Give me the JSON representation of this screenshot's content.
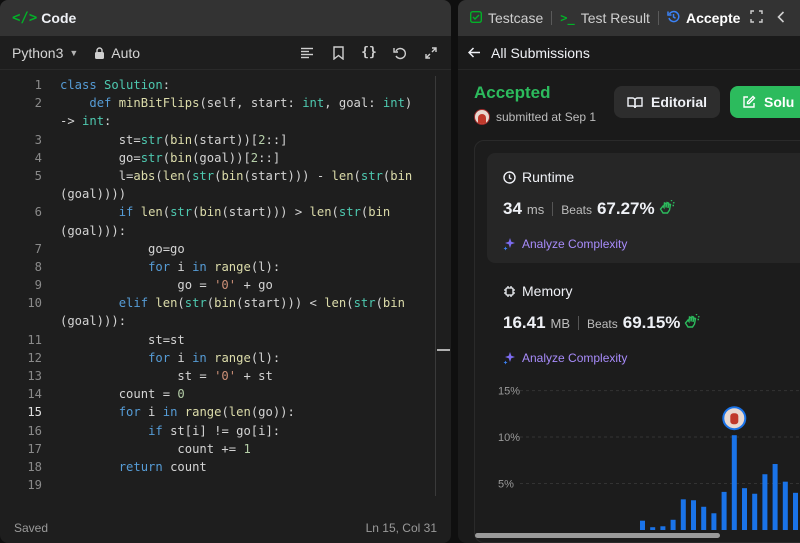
{
  "code_panel": {
    "title": "Code",
    "language": "Python3",
    "auto_label": "Auto",
    "status_saved": "Saved",
    "status_position": "Ln 15, Col 31",
    "active_line": 15
  },
  "code_lines": [
    {
      "n": "1",
      "html": "<span class=\"kw\">class</span> <span class=\"cl\">Solution</span>:"
    },
    {
      "n": "2",
      "html": "    <span class=\"kw\">def</span> <span class=\"fn\">minBitFlips</span>(<span class=\"op\">self</span>, start: <span class=\"bi\">int</span>, goal: <span class=\"bi\">int</span>)"
    },
    {
      "n": "",
      "cont": true,
      "html": "-> <span class=\"bi\">int</span>:"
    },
    {
      "n": "3",
      "html": "        st=<span class=\"bi\">str</span>(<span class=\"fn\">bin</span>(start))[<span class=\"num\">2</span>::]"
    },
    {
      "n": "4",
      "html": "        go=<span class=\"bi\">str</span>(<span class=\"fn\">bin</span>(goal))[<span class=\"num\">2</span>::]"
    },
    {
      "n": "5",
      "html": "        l=<span class=\"fn\">abs</span>(<span class=\"fn\">len</span>(<span class=\"bi\">str</span>(<span class=\"fn\">bin</span>(start))) - <span class=\"fn\">len</span>(<span class=\"bi\">str</span>(<span class=\"fn\">bin</span>"
    },
    {
      "n": "",
      "cont": true,
      "html": "(goal))))"
    },
    {
      "n": "6",
      "html": "        <span class=\"kw\">if</span> <span class=\"fn\">len</span>(<span class=\"bi\">str</span>(<span class=\"fn\">bin</span>(start))) > <span class=\"fn\">len</span>(<span class=\"bi\">str</span>(<span class=\"fn\">bin</span>"
    },
    {
      "n": "",
      "cont": true,
      "html": "(goal))):"
    },
    {
      "n": "7",
      "html": "            go=go"
    },
    {
      "n": "8",
      "html": "            <span class=\"kw\">for</span> i <span class=\"kw\">in</span> <span class=\"fn\">range</span>(l):"
    },
    {
      "n": "9",
      "html": "                go = <span class=\"str\">'0'</span> + go"
    },
    {
      "n": "10",
      "html": "        <span class=\"kw\">elif</span> <span class=\"fn\">len</span>(<span class=\"bi\">str</span>(<span class=\"fn\">bin</span>(start))) < <span class=\"fn\">len</span>(<span class=\"bi\">str</span>(<span class=\"fn\">bin</span>"
    },
    {
      "n": "",
      "cont": true,
      "html": "(goal))):"
    },
    {
      "n": "11",
      "html": "            st=st"
    },
    {
      "n": "12",
      "html": "            <span class=\"kw\">for</span> i <span class=\"kw\">in</span> <span class=\"fn\">range</span>(l):"
    },
    {
      "n": "13",
      "html": "                st = <span class=\"str\">'0'</span> + st"
    },
    {
      "n": "14",
      "html": "        count = <span class=\"num\">0</span>"
    },
    {
      "n": "15",
      "html": "        <span class=\"kw\">for</span> i <span class=\"kw\">in</span> <span class=\"fn\">range</span>(<span class=\"fn\">len</span>(go)):"
    },
    {
      "n": "16",
      "html": "            <span class=\"kw\">if</span> st[i] != go[i]:"
    },
    {
      "n": "17",
      "html": "                count += <span class=\"num\">1</span>"
    },
    {
      "n": "18",
      "html": "        <span class=\"kw\">return</span> count"
    },
    {
      "n": "19",
      "html": ""
    }
  ],
  "result_panel": {
    "tabs": [
      {
        "label": "Testcase"
      },
      {
        "label": "Test Result"
      },
      {
        "label": "Accepte"
      }
    ],
    "back_label": "All Submissions",
    "status": "Accepted",
    "submitted": "submitted at Sep 1",
    "editorial_button": "Editorial",
    "solution_button": "Solu",
    "colors": {
      "accepted": "#2cbb5d",
      "bar": "#1a73e8",
      "analyze": "#a78bfa"
    }
  },
  "runtime": {
    "title": "Runtime",
    "value": "34",
    "unit": "ms",
    "beats_label": "Beats",
    "percent": "67.27%",
    "analyze": "Analyze Complexity"
  },
  "memory": {
    "title": "Memory",
    "value": "16.41",
    "unit": "MB",
    "beats_label": "Beats",
    "percent": "69.15%",
    "analyze": "Analyze Complexity"
  },
  "chart_data": {
    "type": "bar",
    "ytick_labels": [
      "15%",
      "10%",
      "5%"
    ],
    "ylim": [
      0,
      17
    ],
    "values": [
      1.0,
      0.3,
      0.4,
      1.1,
      3.3,
      3.2,
      2.5,
      1.8,
      4.1,
      10.2,
      4.5,
      3.9,
      6.0,
      7.1,
      5.2,
      4.0,
      2.6
    ],
    "highlight_index": 9,
    "grid": true
  }
}
